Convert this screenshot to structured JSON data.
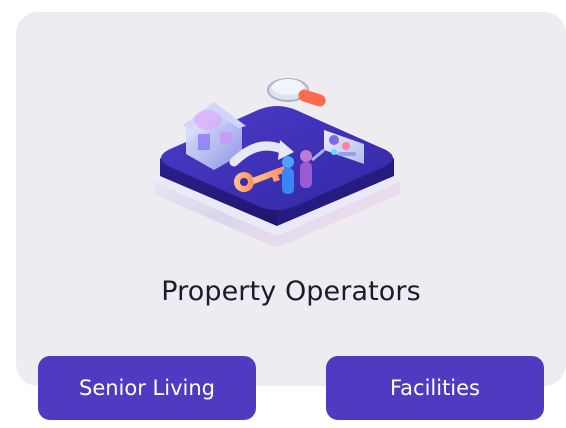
{
  "card": {
    "title": "Property Operators",
    "background": "#eeecf1"
  },
  "buttons": {
    "senior_living": "Senior Living",
    "facilities": "Facilities"
  },
  "colors": {
    "accent": "#4f3bc2",
    "platform_top": "#3d2fb0",
    "text": "#1b1b2a"
  },
  "illustration": {
    "icon": "isometric-property-platform-icon"
  }
}
